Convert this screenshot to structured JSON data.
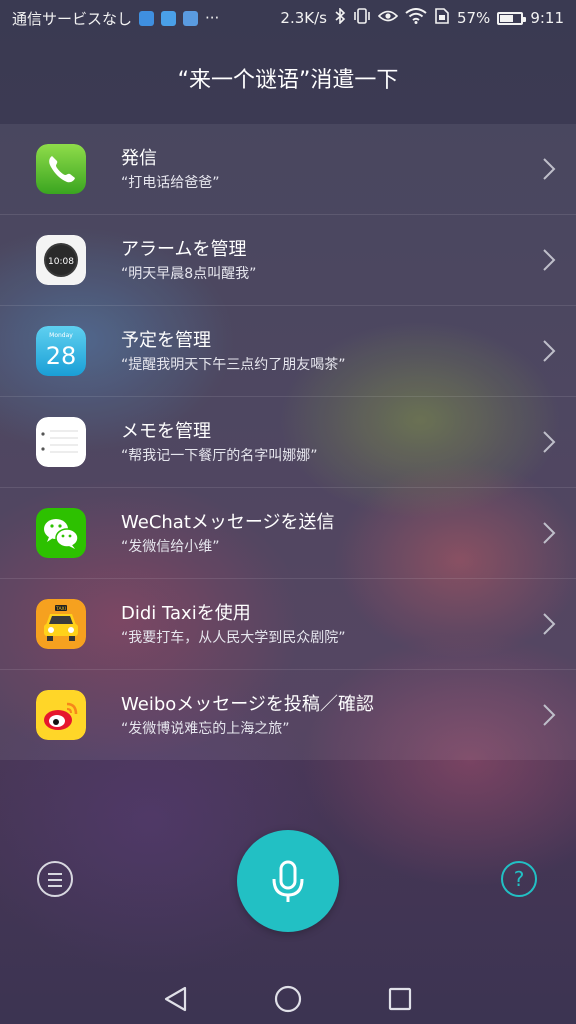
{
  "status_bar": {
    "carrier": "通信サービスなし",
    "more": "···",
    "speed": "2.3K/s",
    "battery": "57%",
    "battery_level": 0.57,
    "time": "9:11"
  },
  "header": {
    "title": "“来一个谜语”消遣一下"
  },
  "commands": [
    {
      "title": "発信",
      "example": "“打电话给爸爸”",
      "icon": "phone-icon"
    },
    {
      "title": "アラームを管理",
      "example": "“明天早晨8点叫醒我”",
      "icon": "alarm-clock-icon",
      "icon_text": "10:08"
    },
    {
      "title": "予定を管理",
      "example": "“提醒我明天下午三点约了朋友喝茶”",
      "icon": "calendar-icon",
      "icon_label": "Monday",
      "icon_day": "28"
    },
    {
      "title": "メモを管理",
      "example": "“帮我记一下餐厅的名字叫娜娜”",
      "icon": "notepad-icon"
    },
    {
      "title": "WeChatメッセージを送信",
      "example": "“发微信给小维”",
      "icon": "wechat-icon"
    },
    {
      "title": "Didi Taxiを使用",
      "example": "“我要打车，从人民大学到民众剧院”",
      "icon": "taxi-icon",
      "icon_text": "TAXI"
    },
    {
      "title": "Weiboメッセージを投稿／確認",
      "example": "“发微博说难忘的上海之旅”",
      "icon": "weibo-icon"
    }
  ],
  "bottom": {
    "help_label": "?",
    "accent": "#22c0c4"
  }
}
